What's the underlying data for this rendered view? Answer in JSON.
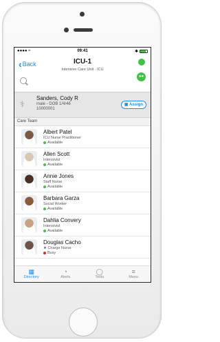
{
  "status_bar": {
    "signal": "●●●● ≈",
    "time": "09:41",
    "bluetooth": "✱"
  },
  "nav": {
    "back_label": "Back",
    "title": "ICU-1",
    "subtitle": "Intensive Care Unit - ICU"
  },
  "patient": {
    "name": "Sanders, Cody R",
    "details": "male - DOB 1/4/46",
    "mrn": "10000001",
    "assign_label": "Assign"
  },
  "section_title": "Care Team",
  "care_team": [
    {
      "name": "Albert Patel",
      "role": "ICU Nurse Practitioner",
      "status": "Available",
      "status_color": "#43c146",
      "avatar_color": "#7b5a44"
    },
    {
      "name": "Allen Scott",
      "role": "Intensivist",
      "status": "Available",
      "status_color": "#43c146",
      "avatar_color": "#d9c7b4"
    },
    {
      "name": "Annie Jones",
      "role": "Staff Nurse",
      "status": "Available",
      "status_color": "#43c146",
      "avatar_color": "#4a2f24"
    },
    {
      "name": "Barbara Garza",
      "role": "Social Worker",
      "status": "Available",
      "status_color": "#43c146",
      "avatar_color": "#8c5a3c"
    },
    {
      "name": "Dahlia Convery",
      "role": "Intensivist",
      "status": "Available",
      "status_color": "#43c146",
      "avatar_color": "#c9a184"
    },
    {
      "name": "Douglas Cacho",
      "role": "★ Charge Nurse",
      "status": "Busy",
      "status_color": "#e02828",
      "avatar_color": "#6f5546"
    }
  ],
  "tabs": [
    {
      "label": "Directory",
      "icon": "directory-icon",
      "active": true
    },
    {
      "label": "Alerts",
      "icon": "alerts-icon",
      "active": false
    },
    {
      "label": "Texts",
      "icon": "texts-icon",
      "active": false
    },
    {
      "label": "Menu",
      "icon": "menu-icon",
      "active": false
    }
  ],
  "colors": {
    "accent": "#1a8ef0",
    "available": "#43c146",
    "busy": "#e02828"
  }
}
